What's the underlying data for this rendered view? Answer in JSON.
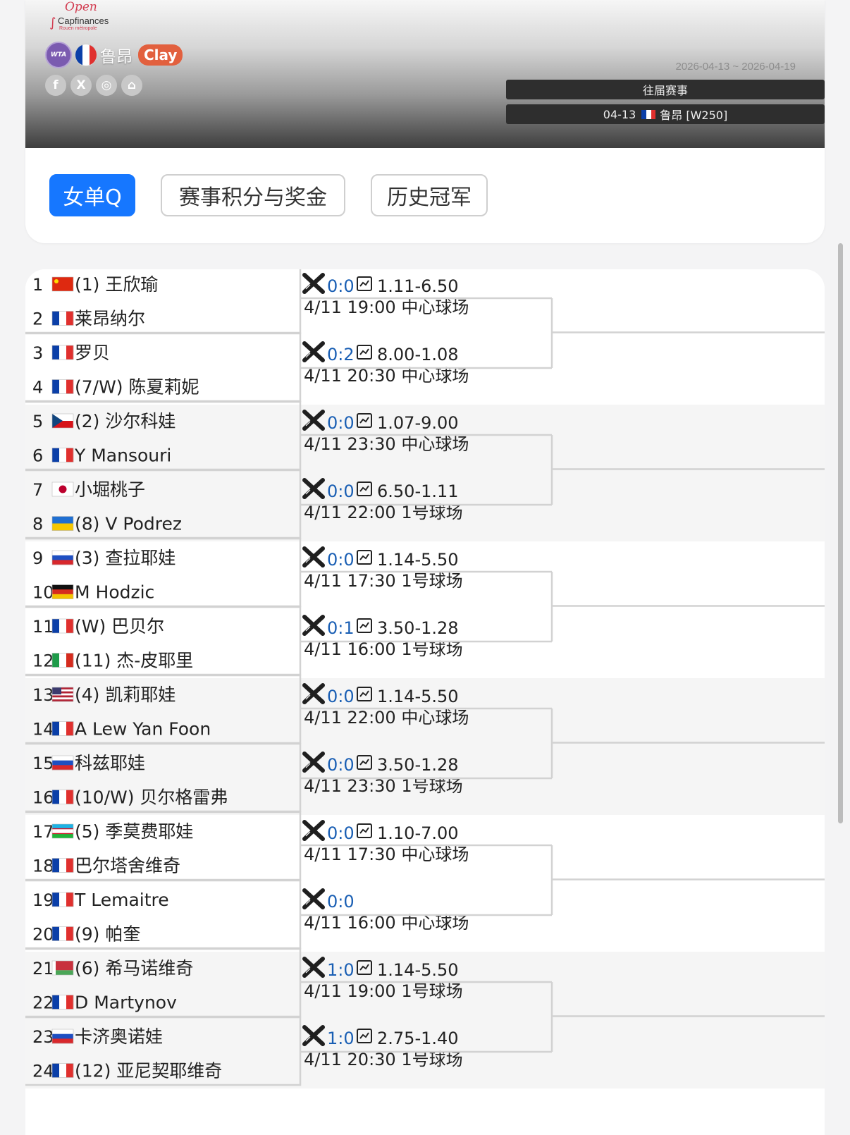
{
  "header": {
    "logo": {
      "line1": "Open",
      "line2": "Capfinances",
      "line3": "Rouen métropole"
    },
    "tour_badge": "WTA",
    "city": "鲁昂",
    "surface": "Clay",
    "date_range": "2026-04-13 ~ 2026-04-19",
    "history_button": "往届赛事",
    "edition_button": {
      "date": "04-13",
      "label": "鲁昂 [W250]"
    },
    "social": [
      {
        "icon": "facebook-icon",
        "glyph": "f"
      },
      {
        "icon": "x-icon",
        "glyph": "X"
      },
      {
        "icon": "instagram-icon",
        "glyph": "◎"
      },
      {
        "icon": "home-icon",
        "glyph": "⌂"
      }
    ]
  },
  "tabs": [
    "女单Q",
    "赛事积分与奖金",
    "历史冠军"
  ],
  "active_tab": 0,
  "colors": {
    "accent": "#1677ff",
    "surface": "#e2603e",
    "score": "#1a5fb4",
    "line": "#d2d2d2"
  },
  "flags": {
    "CN": {
      "type": "cn"
    },
    "FR": {
      "type": "v",
      "colors": [
        "#0b3fa8",
        "#ffffff",
        "#e0302e"
      ]
    },
    "CZ": {
      "type": "cz"
    },
    "JP": {
      "type": "jp"
    },
    "UA": {
      "type": "h",
      "colors": [
        "#1f6fd1",
        "#f6c700"
      ]
    },
    "RU": {
      "type": "h",
      "colors": [
        "#ffffff",
        "#1e4fc2",
        "#d8282c"
      ]
    },
    "DE": {
      "type": "h",
      "colors": [
        "#111111",
        "#d52b1e",
        "#f3c300"
      ]
    },
    "IT": {
      "type": "v",
      "colors": [
        "#1e9b49",
        "#ffffff",
        "#d52b1e"
      ]
    },
    "US": {
      "type": "us"
    },
    "UZ": {
      "type": "uz"
    },
    "BY": {
      "type": "by"
    }
  },
  "players": [
    {
      "num": "1",
      "flag": "CN",
      "seed": "(1)",
      "name": "王欣瑜"
    },
    {
      "num": "2",
      "flag": "FR",
      "seed": "",
      "name": "莱昂纳尔"
    },
    {
      "num": "3",
      "flag": "FR",
      "seed": "",
      "name": "罗贝"
    },
    {
      "num": "4",
      "flag": "FR",
      "seed": "(7/W)",
      "name": "陈夏莉妮"
    },
    {
      "num": "5",
      "flag": "CZ",
      "seed": "(2)",
      "name": "沙尔科娃"
    },
    {
      "num": "6",
      "flag": "FR",
      "seed": "",
      "name": "Y Mansouri"
    },
    {
      "num": "7",
      "flag": "JP",
      "seed": "",
      "name": "小堀桃子"
    },
    {
      "num": "8",
      "flag": "UA",
      "seed": "(8)",
      "name": "V Podrez"
    },
    {
      "num": "9",
      "flag": "RU",
      "seed": "(3)",
      "name": "查拉耶娃"
    },
    {
      "num": "10",
      "flag": "DE",
      "seed": "",
      "name": "M Hodzic"
    },
    {
      "num": "11",
      "flag": "FR",
      "seed": "(W)",
      "name": "巴贝尔"
    },
    {
      "num": "12",
      "flag": "IT",
      "seed": "(11)",
      "name": "杰-皮耶里"
    },
    {
      "num": "13",
      "flag": "US",
      "seed": "(4)",
      "name": "凯莉耶娃"
    },
    {
      "num": "14",
      "flag": "FR",
      "seed": "",
      "name": "A Lew Yan Foon"
    },
    {
      "num": "15",
      "flag": "RU",
      "seed": "",
      "name": "科兹耶娃"
    },
    {
      "num": "16",
      "flag": "FR",
      "seed": "(10/W)",
      "name": "贝尔格雷弗"
    },
    {
      "num": "17",
      "flag": "UZ",
      "seed": "(5)",
      "name": "季莫费耶娃"
    },
    {
      "num": "18",
      "flag": "FR",
      "seed": "",
      "name": "巴尔塔舍维奇"
    },
    {
      "num": "19",
      "flag": "FR",
      "seed": "",
      "name": "T Lemaitre"
    },
    {
      "num": "20",
      "flag": "FR",
      "seed": "(9)",
      "name": "帕奎"
    },
    {
      "num": "21",
      "flag": "BY",
      "seed": "(6)",
      "name": "希马诺维奇"
    },
    {
      "num": "22",
      "flag": "FR",
      "seed": "",
      "name": "D Martynov"
    },
    {
      "num": "23",
      "flag": "RU",
      "seed": "",
      "name": "卡济奥诺娃"
    },
    {
      "num": "24",
      "flag": "FR",
      "seed": "(12)",
      "name": "亚尼契耶维奇"
    }
  ],
  "matches": [
    {
      "score": "0:0",
      "odds": "1.11-6.50",
      "time": "4/11 19:00 中心球场"
    },
    {
      "score": "0:2",
      "odds": "8.00-1.08",
      "time": "4/11 20:30 中心球场"
    },
    {
      "score": "0:0",
      "odds": "1.07-9.00",
      "time": "4/11 23:30 中心球场"
    },
    {
      "score": "0:0",
      "odds": "6.50-1.11",
      "time": "4/11 22:00 1号球场"
    },
    {
      "score": "0:0",
      "odds": "1.14-5.50",
      "time": "4/11 17:30 1号球场"
    },
    {
      "score": "0:1",
      "odds": "3.50-1.28",
      "time": "4/11 16:00 1号球场"
    },
    {
      "score": "0:0",
      "odds": "1.14-5.50",
      "time": "4/11 22:00 中心球场"
    },
    {
      "score": "0:0",
      "odds": "3.50-1.28",
      "time": "4/11 23:30 1号球场"
    },
    {
      "score": "0:0",
      "odds": "1.10-7.00",
      "time": "4/11 17:30 中心球场"
    },
    {
      "score": "0:0",
      "odds": "",
      "time": "4/11 16:00 中心球场"
    },
    {
      "score": "1:0",
      "odds": "1.14-5.50",
      "time": "4/11 19:00 1号球场"
    },
    {
      "score": "1:0",
      "odds": "2.75-1.40",
      "time": "4/11 20:30 1号球场"
    }
  ]
}
